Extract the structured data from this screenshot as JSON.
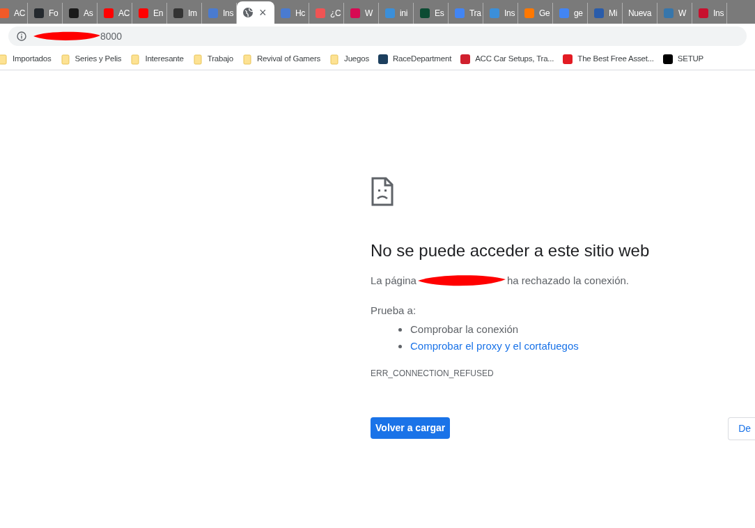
{
  "tabs": [
    {
      "title": "AC",
      "color": "#f05a28",
      "selected": false
    },
    {
      "title": "Fo",
      "color": "#24292e",
      "selected": false
    },
    {
      "title": "As",
      "color": "#1a1a1a",
      "selected": false
    },
    {
      "title": "AC",
      "color": "#ff0000",
      "selected": false
    },
    {
      "title": "En",
      "color": "#ff0000",
      "selected": false
    },
    {
      "title": "Im",
      "color": "#333333",
      "selected": false
    },
    {
      "title": "Ins",
      "color": "#4a7bd0",
      "selected": false
    },
    {
      "color": "#5f6368",
      "selected": true,
      "close": "×"
    },
    {
      "title": "Hc",
      "color": "#4a7bd0",
      "selected": false
    },
    {
      "title": "¿C",
      "color": "#f05454",
      "selected": false
    },
    {
      "title": "W",
      "color": "#d70a53",
      "selected": false
    },
    {
      "title": "ini",
      "color": "#3b8fd9",
      "selected": false
    },
    {
      "title": "Es",
      "color": "#0c4b33",
      "selected": false
    },
    {
      "title": "Tra",
      "color": "#4285f4",
      "selected": false
    },
    {
      "title": "Ins",
      "color": "#3b8fd9",
      "selected": false
    },
    {
      "title": "Ge",
      "color": "#ff7800",
      "selected": false
    },
    {
      "title": "ge",
      "color": "#4285f4",
      "selected": false
    },
    {
      "title": "Mi",
      "color": "#2a5caa",
      "selected": false
    },
    {
      "title": "Nueva",
      "selected": false
    },
    {
      "title": "W",
      "color": "#3776ab",
      "selected": false
    },
    {
      "title": "Ins",
      "color": "#c8102e",
      "selected": false
    }
  ],
  "address_bar": {
    "url": "8000"
  },
  "bookmarks": [
    {
      "kind": "folder",
      "label": "Importados"
    },
    {
      "kind": "folder",
      "label": "Series y Pelis"
    },
    {
      "kind": "folder",
      "label": "Interesante"
    },
    {
      "kind": "folder",
      "label": "Trabajo"
    },
    {
      "kind": "folder",
      "label": "Revival of Gamers"
    },
    {
      "kind": "folder",
      "label": "Juegos"
    },
    {
      "kind": "site",
      "label": "RaceDepartment",
      "color": "#1c3f5e"
    },
    {
      "kind": "site",
      "label": "ACC Car Setups, Tra...",
      "color": "#d0202e"
    },
    {
      "kind": "site",
      "label": "The Best Free Asset...",
      "color": "#e31b23"
    },
    {
      "kind": "site",
      "label": "SETUP",
      "color": "#000000"
    }
  ],
  "error": {
    "heading": "No se puede acceder a este sitio web",
    "message_start": "La página",
    "message_end": "ha rechazado la conexión.",
    "try_label": "Prueba a:",
    "suggestions": [
      {
        "text": "Comprobar la conexión",
        "link": false
      },
      {
        "text": "Comprobar el proxy y el cortafuegos",
        "link": true
      }
    ],
    "code": "ERR_CONNECTION_REFUSED",
    "reload_button": "Volver a cargar",
    "details_button": "De"
  }
}
